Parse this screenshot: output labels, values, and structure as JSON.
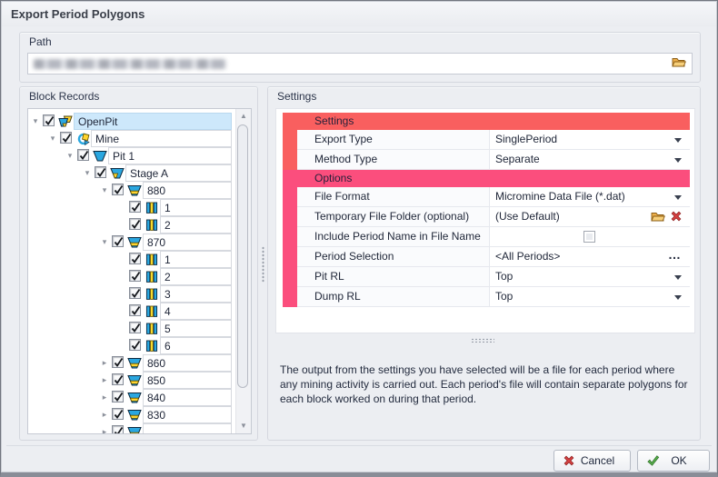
{
  "window": {
    "title": "Export Period Polygons"
  },
  "path_section": {
    "label": "Path"
  },
  "block_records": {
    "label": "Block Records",
    "tree": [
      {
        "level": 0,
        "expander": "expanded",
        "icon": "openpit",
        "label": "OpenPit",
        "checked": true,
        "selected": true
      },
      {
        "level": 1,
        "expander": "expanded",
        "icon": "mine",
        "label": "Mine",
        "checked": true
      },
      {
        "level": 2,
        "expander": "expanded",
        "icon": "pit",
        "label": "Pit 1",
        "checked": true
      },
      {
        "level": 3,
        "expander": "expanded",
        "icon": "stage",
        "label": "Stage A",
        "checked": true
      },
      {
        "level": 4,
        "expander": "expanded",
        "icon": "bench",
        "label": "880",
        "checked": true
      },
      {
        "level": 5,
        "expander": "none",
        "icon": "block",
        "label": "1",
        "checked": true
      },
      {
        "level": 5,
        "expander": "none",
        "icon": "block",
        "label": "2",
        "checked": true
      },
      {
        "level": 4,
        "expander": "expanded",
        "icon": "bench",
        "label": "870",
        "checked": true
      },
      {
        "level": 5,
        "expander": "none",
        "icon": "block",
        "label": "1",
        "checked": true
      },
      {
        "level": 5,
        "expander": "none",
        "icon": "block",
        "label": "2",
        "checked": true
      },
      {
        "level": 5,
        "expander": "none",
        "icon": "block",
        "label": "3",
        "checked": true
      },
      {
        "level": 5,
        "expander": "none",
        "icon": "block",
        "label": "4",
        "checked": true
      },
      {
        "level": 5,
        "expander": "none",
        "icon": "block",
        "label": "5",
        "checked": true
      },
      {
        "level": 5,
        "expander": "none",
        "icon": "block",
        "label": "6",
        "checked": true
      },
      {
        "level": 4,
        "expander": "collapsed",
        "icon": "bench",
        "label": "860",
        "checked": true
      },
      {
        "level": 4,
        "expander": "collapsed",
        "icon": "bench",
        "label": "850",
        "checked": true
      },
      {
        "level": 4,
        "expander": "collapsed",
        "icon": "bench",
        "label": "840",
        "checked": true
      },
      {
        "level": 4,
        "expander": "collapsed",
        "icon": "bench",
        "label": "830",
        "checked": true
      },
      {
        "level": 4,
        "expander": "collapsed",
        "icon": "bench",
        "label": "",
        "checked": true,
        "clipped": true
      }
    ]
  },
  "settings_panel": {
    "label": "Settings",
    "rows": [
      {
        "type": "category",
        "label": "Settings",
        "accent": "#f95f5f"
      },
      {
        "type": "dropdown",
        "label": "Export Type",
        "value": "SinglePeriod",
        "accent": "#f95f5f"
      },
      {
        "type": "dropdown",
        "label": "Method Type",
        "value": "Separate",
        "accent": "#f95f5f"
      },
      {
        "type": "category",
        "label": "Options",
        "accent": "#fb4e7d"
      },
      {
        "type": "dropdown",
        "label": "File Format",
        "value": "Micromine Data File (*.dat)",
        "accent": "#fb4e7d"
      },
      {
        "type": "folder-clear",
        "label": "Temporary File Folder (optional)",
        "value": "(Use Default)",
        "accent": "#fb4e7d"
      },
      {
        "type": "checkbox",
        "label": "Include Period Name in File Name",
        "checked": false,
        "accent": "#fb4e7d"
      },
      {
        "type": "ellipsis",
        "label": "Period Selection",
        "value": "<All Periods>",
        "accent": "#fb4e7d"
      },
      {
        "type": "dropdown",
        "label": "Pit RL",
        "value": "Top",
        "accent": "#fb4e7d"
      },
      {
        "type": "dropdown",
        "label": "Dump RL",
        "value": "Top",
        "accent": "#fb4e7d"
      }
    ],
    "description": "The output from the settings you have selected will be a file for each period where any mining activity is carried out. Each period's file will contain separate polygons for each block worked on during that period."
  },
  "footer": {
    "cancel_label": "Cancel",
    "ok_label": "OK"
  }
}
